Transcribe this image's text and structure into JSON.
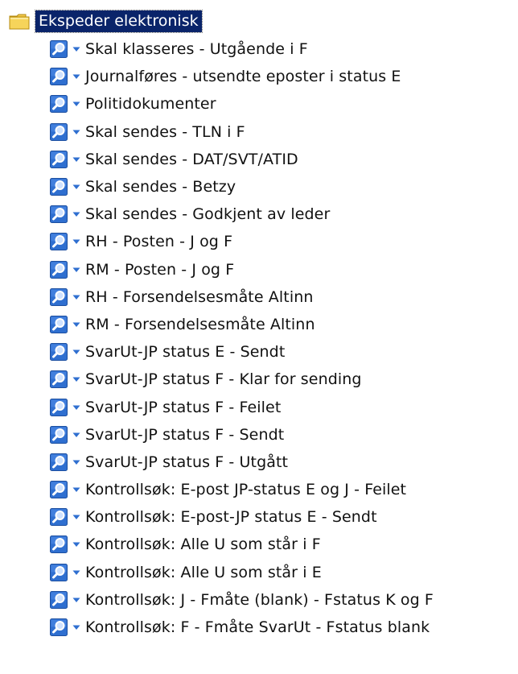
{
  "tree": {
    "root": {
      "label": "Ekspeder elektronisk",
      "icon": "folder-icon"
    },
    "items": [
      {
        "label": "Skal klasseres - Utgående i F"
      },
      {
        "label": "Journalføres - utsendte eposter i status E"
      },
      {
        "label": "Politidokumenter"
      },
      {
        "label": "Skal sendes - TLN i F"
      },
      {
        "label": "Skal sendes - DAT/SVT/ATID"
      },
      {
        "label": "Skal sendes - Betzy"
      },
      {
        "label": "Skal sendes - Godkjent av leder"
      },
      {
        "label": "RH - Posten - J og F"
      },
      {
        "label": "RM - Posten - J og F"
      },
      {
        "label": "RH - Forsendelsesmåte Altinn"
      },
      {
        "label": "RM - Forsendelsesmåte Altinn"
      },
      {
        "label": "SvarUt-JP status E - Sendt"
      },
      {
        "label": "SvarUt-JP status F - Klar for sending"
      },
      {
        "label": "SvarUt-JP status F - Feilet"
      },
      {
        "label": "SvarUt-JP status F - Sendt"
      },
      {
        "label": "SvarUt-JP status F - Utgått"
      },
      {
        "label": "Kontrollsøk: E-post JP-status E og J - Feilet"
      },
      {
        "label": "Kontrollsøk: E-post-JP status E - Sendt"
      },
      {
        "label": "Kontrollsøk: Alle U som står i F"
      },
      {
        "label": "Kontrollsøk: Alle U som står i E"
      },
      {
        "label": "Kontrollsøk: J - Fmåte (blank) - Fstatus K og F"
      },
      {
        "label": "Kontrollsøk: F - Fmåte SvarUt - Fstatus blank"
      }
    ],
    "item_icon": "search-icon",
    "item_dropdown_icon": "caret-down-icon",
    "colors": {
      "selection": "#0a246a",
      "icon_blue": "#2f6fd0",
      "caret_blue": "#2f6fd0",
      "folder_yellow": "#f6d45a"
    }
  }
}
